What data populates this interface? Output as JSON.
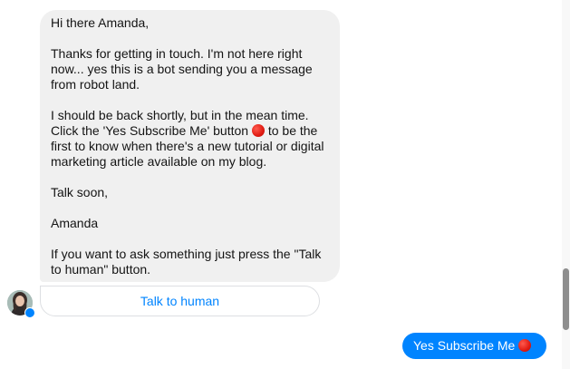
{
  "conversation": {
    "received_message": {
      "greeting": "Hi there Amanda,",
      "paragraph_1": "Thanks for getting in touch. I'm not here right now... yes this is a bot sending you a message from robot land.",
      "paragraph_2_before": "I should be back shortly, but in the mean time. Click the 'Yes Subscribe Me' button ",
      "paragraph_2_after": " to be the first to know when there's a new tutorial or digital marketing article available on my blog.",
      "signoff": "Talk soon,",
      "signature": "Amanda",
      "paragraph_3": "If you want to ask something just press the \"Talk to human\" button."
    },
    "quick_reply": {
      "label": "Talk to human"
    },
    "sent_message": {
      "text": "Yes Subscribe Me"
    }
  },
  "colors": {
    "accent": "#0084ff",
    "received_bubble": "#f0f0f0",
    "red_dot": "#e01b12"
  },
  "icons": {
    "emoji": "red-circle-icon",
    "avatar": "avatar-photo",
    "badge": "messenger-badge-icon"
  }
}
